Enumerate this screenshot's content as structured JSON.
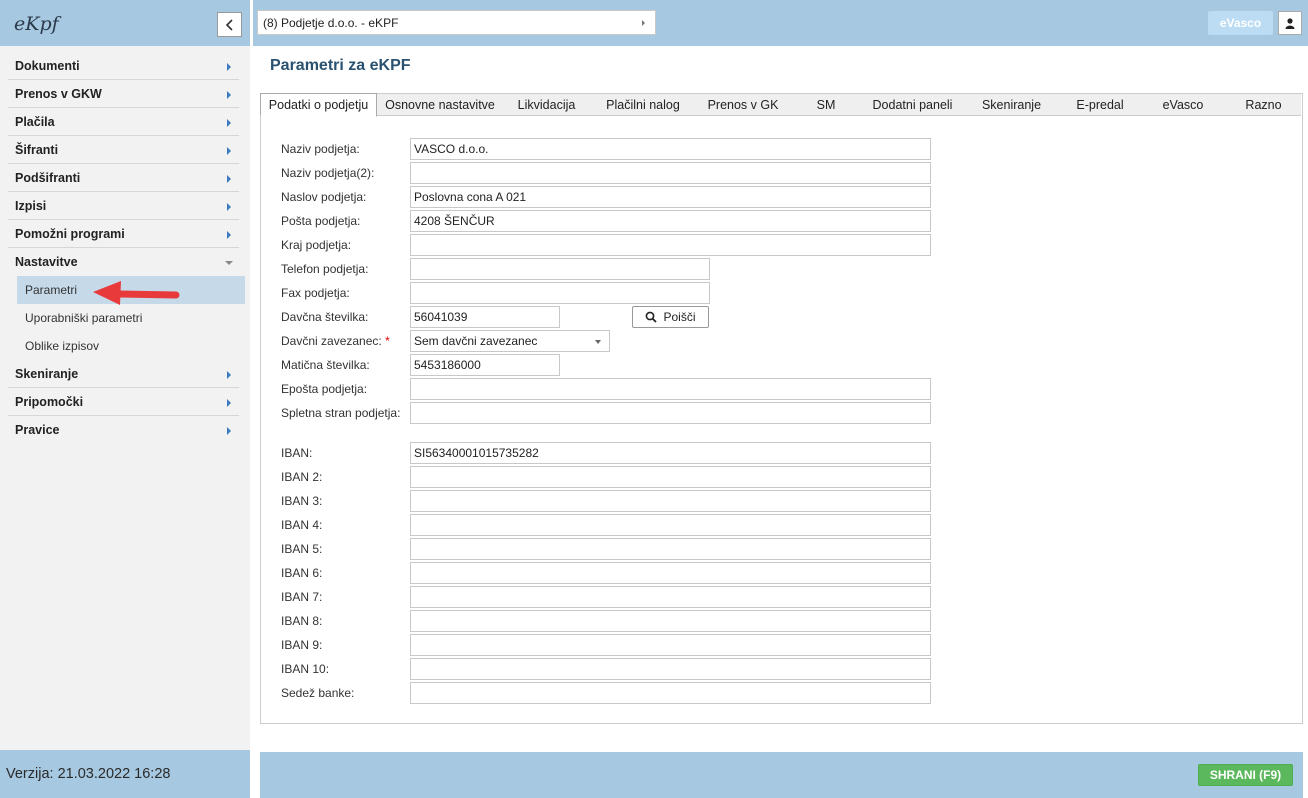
{
  "app": {
    "logo": "eKpf",
    "version": "Verzija: 21.03.2022 16:28"
  },
  "company": {
    "selected": "(8) Podjetje d.o.o. - eKPF"
  },
  "header": {
    "evasco_label": "eVasco"
  },
  "sidebar": {
    "items": [
      {
        "label": "Dokumenti"
      },
      {
        "label": "Prenos v GKW"
      },
      {
        "label": "Plačila"
      },
      {
        "label": "Šifranti"
      },
      {
        "label": "Podšifranti"
      },
      {
        "label": "Izpisi"
      },
      {
        "label": "Pomožni programi"
      },
      {
        "label": "Nastavitve"
      },
      {
        "label": "Skeniranje"
      },
      {
        "label": "Pripomočki"
      },
      {
        "label": "Pravice"
      }
    ],
    "sub_items": [
      {
        "label": "Parametri"
      },
      {
        "label": "Uporabniški parametri"
      },
      {
        "label": "Oblike izpisov"
      }
    ]
  },
  "page": {
    "title": "Parametri za eKPF"
  },
  "tabs": [
    {
      "label": "Podatki o podjetju"
    },
    {
      "label": "Osnovne nastavitve"
    },
    {
      "label": "Likvidacija"
    },
    {
      "label": "Plačilni nalog"
    },
    {
      "label": "Prenos v GK"
    },
    {
      "label": "SM"
    },
    {
      "label": "Dodatni paneli"
    },
    {
      "label": "Skeniranje"
    },
    {
      "label": "E-predal"
    },
    {
      "label": "eVasco"
    },
    {
      "label": "Razno"
    }
  ],
  "form": {
    "naziv": {
      "label": "Naziv podjetja:",
      "value": "VASCO d.o.o."
    },
    "naziv2": {
      "label": "Naziv podjetja(2):",
      "value": ""
    },
    "naslov": {
      "label": "Naslov podjetja:",
      "value": "Poslovna cona A 021"
    },
    "posta": {
      "label": "Pošta podjetja:",
      "value": "4208 ŠENČUR"
    },
    "kraj": {
      "label": "Kraj podjetja:",
      "value": ""
    },
    "telefon": {
      "label": "Telefon podjetja:",
      "value": ""
    },
    "fax": {
      "label": "Fax podjetja:",
      "value": ""
    },
    "davcna": {
      "label": "Davčna številka:",
      "value": "56041039"
    },
    "search_label": "Poišči",
    "zavezanec": {
      "label": "Davčni zavezanec:",
      "required_mark": "*",
      "value": "Sem davčni zavezanec"
    },
    "maticna": {
      "label": "Matična številka:",
      "value": "5453186000"
    },
    "eposta": {
      "label": "Epošta podjetja:",
      "value": ""
    },
    "spletna": {
      "label": "Spletna stran podjetja:",
      "value": ""
    },
    "iban": [
      {
        "label": "IBAN:",
        "value": "SI56340001015735282"
      },
      {
        "label": "IBAN 2:",
        "value": ""
      },
      {
        "label": "IBAN 3:",
        "value": ""
      },
      {
        "label": "IBAN 4:",
        "value": ""
      },
      {
        "label": "IBAN 5:",
        "value": ""
      },
      {
        "label": "IBAN 6:",
        "value": ""
      },
      {
        "label": "IBAN 7:",
        "value": ""
      },
      {
        "label": "IBAN 8:",
        "value": ""
      },
      {
        "label": "IBAN 9:",
        "value": ""
      },
      {
        "label": "IBAN 10:",
        "value": ""
      }
    ],
    "sedez": {
      "label": "Sedež banke:",
      "value": ""
    }
  },
  "footer": {
    "save_label": "SHRANI (F9)"
  },
  "colors": {
    "bar": "#a6c8e0",
    "title": "#2a5270",
    "save": "#5cb85c",
    "active_menu": "#c5d9e9",
    "arrow_red": "#e83a3a"
  }
}
